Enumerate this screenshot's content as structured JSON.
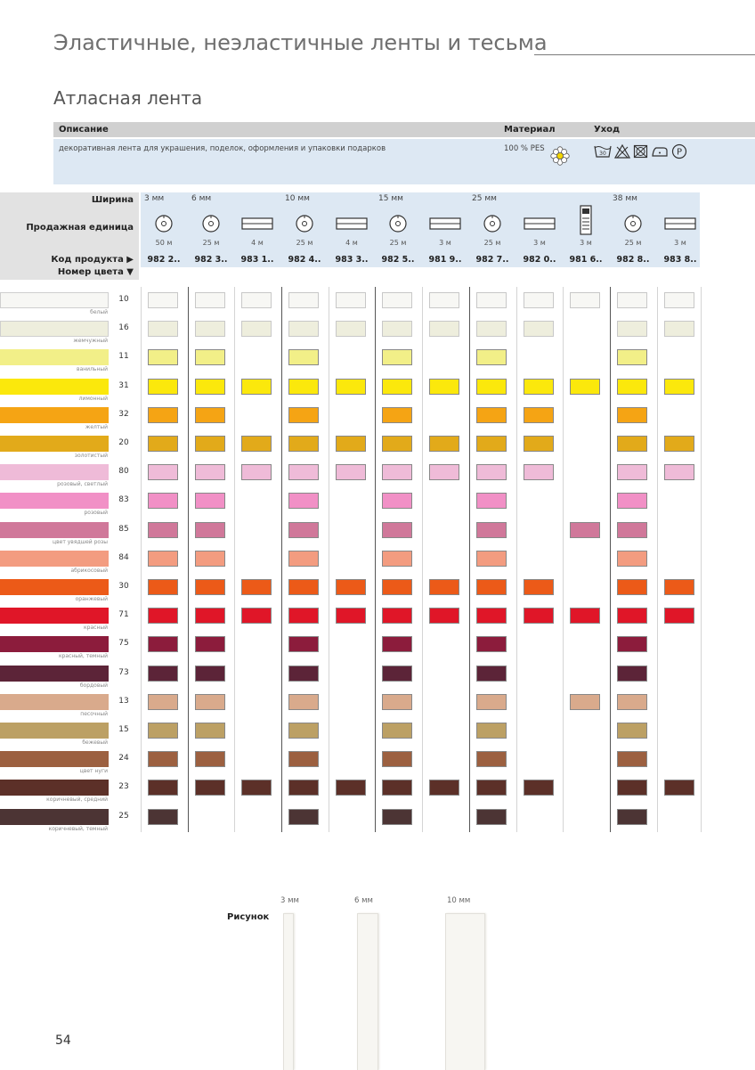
{
  "page_title": "Эластичные, неэластичные ленты и тесьма",
  "section_title": "Атласная лента",
  "info": {
    "headers": {
      "description": "Описание",
      "material": "Материал",
      "care": "Уход"
    },
    "description": "декоративная лента для украшения, поделок, оформления и упаковки подарков",
    "material": "100 % PES",
    "care_icons": [
      "wash-30-icon",
      "no-bleach-icon",
      "no-tumble-dry-icon",
      "iron-low-icon",
      "dry-clean-p-icon"
    ]
  },
  "table": {
    "labels": {
      "width": "Ширина",
      "unit": "Продажная единица",
      "code": "Код продукта ▶",
      "color_num": "Номер цвета ▼"
    },
    "widths": [
      "3 мм",
      "6 мм",
      "10 мм",
      "15 мм",
      "25 мм",
      "38 мм"
    ],
    "columns": [
      {
        "unit": "spool",
        "len": "50 м",
        "code": "982 2.."
      },
      {
        "unit": "spool",
        "len": "25 м",
        "code": "982 3.."
      },
      {
        "unit": "card",
        "len": "4 м",
        "code": "983 1.."
      },
      {
        "unit": "spool",
        "len": "25 м",
        "code": "982 4.."
      },
      {
        "unit": "card",
        "len": "4 м",
        "code": "983 3.."
      },
      {
        "unit": "spool",
        "len": "25 м",
        "code": "982 5.."
      },
      {
        "unit": "card",
        "len": "3 м",
        "code": "981 9.."
      },
      {
        "unit": "spool",
        "len": "25 м",
        "code": "982 7.."
      },
      {
        "unit": "card",
        "len": "3 м",
        "code": "982 0.."
      },
      {
        "unit": "package",
        "len": "3 м",
        "code": "981 6.."
      },
      {
        "unit": "spool",
        "len": "25 м",
        "code": "982 8.."
      },
      {
        "unit": "card",
        "len": "3 м",
        "code": "983 8.."
      }
    ],
    "rows": [
      {
        "num": "10",
        "name": "белый",
        "color": "#f7f7f4",
        "avail": [
          1,
          1,
          1,
          1,
          1,
          1,
          1,
          1,
          1,
          1,
          1,
          1
        ]
      },
      {
        "num": "16",
        "name": "жемчужный",
        "color": "#eeeedd",
        "avail": [
          1,
          1,
          1,
          1,
          1,
          1,
          1,
          1,
          1,
          0,
          1,
          1
        ]
      },
      {
        "num": "11",
        "name": "ванильный",
        "color": "#f2ef88",
        "avail": [
          1,
          1,
          0,
          1,
          0,
          1,
          0,
          1,
          0,
          0,
          1,
          0
        ]
      },
      {
        "num": "31",
        "name": "лимонный",
        "color": "#fbe80c",
        "avail": [
          1,
          1,
          1,
          1,
          1,
          1,
          1,
          1,
          1,
          1,
          1,
          1
        ]
      },
      {
        "num": "32",
        "name": "желтый",
        "color": "#f5a414",
        "avail": [
          1,
          1,
          0,
          1,
          0,
          1,
          0,
          1,
          1,
          0,
          1,
          0
        ]
      },
      {
        "num": "20",
        "name": "золотистый",
        "color": "#e2aa1a",
        "avail": [
          1,
          1,
          1,
          1,
          1,
          1,
          1,
          1,
          1,
          0,
          1,
          1
        ]
      },
      {
        "num": "80",
        "name": "розовый, светлый",
        "color": "#efbbd8",
        "avail": [
          1,
          1,
          1,
          1,
          1,
          1,
          1,
          1,
          1,
          0,
          1,
          1
        ]
      },
      {
        "num": "83",
        "name": "розовый",
        "color": "#f190c6",
        "avail": [
          1,
          1,
          0,
          1,
          0,
          1,
          0,
          1,
          0,
          0,
          1,
          0
        ]
      },
      {
        "num": "85",
        "name": "цвет увядшей розы",
        "color": "#d0789a",
        "avail": [
          1,
          1,
          0,
          1,
          0,
          1,
          0,
          1,
          0,
          1,
          1,
          0
        ]
      },
      {
        "num": "84",
        "name": "абрикосовый",
        "color": "#f39c80",
        "avail": [
          1,
          1,
          0,
          1,
          0,
          1,
          0,
          1,
          0,
          0,
          1,
          0
        ]
      },
      {
        "num": "30",
        "name": "оранжевый",
        "color": "#ec5a18",
        "avail": [
          1,
          1,
          1,
          1,
          1,
          1,
          1,
          1,
          1,
          0,
          1,
          1
        ]
      },
      {
        "num": "71",
        "name": "красный",
        "color": "#e01628",
        "avail": [
          1,
          1,
          1,
          1,
          1,
          1,
          1,
          1,
          1,
          1,
          1,
          1
        ]
      },
      {
        "num": "75",
        "name": "красный, темный",
        "color": "#8c1c3c",
        "avail": [
          1,
          1,
          0,
          1,
          0,
          1,
          0,
          1,
          0,
          0,
          1,
          0
        ]
      },
      {
        "num": "73",
        "name": "бордовый",
        "color": "#5c2438",
        "avail": [
          1,
          1,
          0,
          1,
          0,
          1,
          0,
          1,
          0,
          0,
          1,
          0
        ]
      },
      {
        "num": "13",
        "name": "песочный",
        "color": "#d9aa8c",
        "avail": [
          1,
          1,
          0,
          1,
          0,
          1,
          0,
          1,
          0,
          1,
          1,
          0
        ]
      },
      {
        "num": "15",
        "name": "бежевый",
        "color": "#bca064",
        "avail": [
          1,
          1,
          0,
          1,
          0,
          1,
          0,
          1,
          0,
          0,
          1,
          0
        ]
      },
      {
        "num": "24",
        "name": "цвет нуги",
        "color": "#9c6040",
        "avail": [
          1,
          1,
          0,
          1,
          0,
          1,
          0,
          1,
          0,
          0,
          1,
          0
        ]
      },
      {
        "num": "23",
        "name": "коричневый, средний",
        "color": "#5c3028",
        "avail": [
          1,
          1,
          1,
          1,
          1,
          1,
          1,
          1,
          1,
          0,
          1,
          1
        ]
      },
      {
        "num": "25",
        "name": "коричневый, темный",
        "color": "#4c3434",
        "avail": [
          1,
          0,
          0,
          1,
          0,
          1,
          0,
          1,
          0,
          0,
          1,
          0
        ]
      }
    ]
  },
  "picture": {
    "label": "Рисунок",
    "widths": [
      "3 мм",
      "6 мм",
      "10 мм"
    ]
  },
  "page_number": "54"
}
